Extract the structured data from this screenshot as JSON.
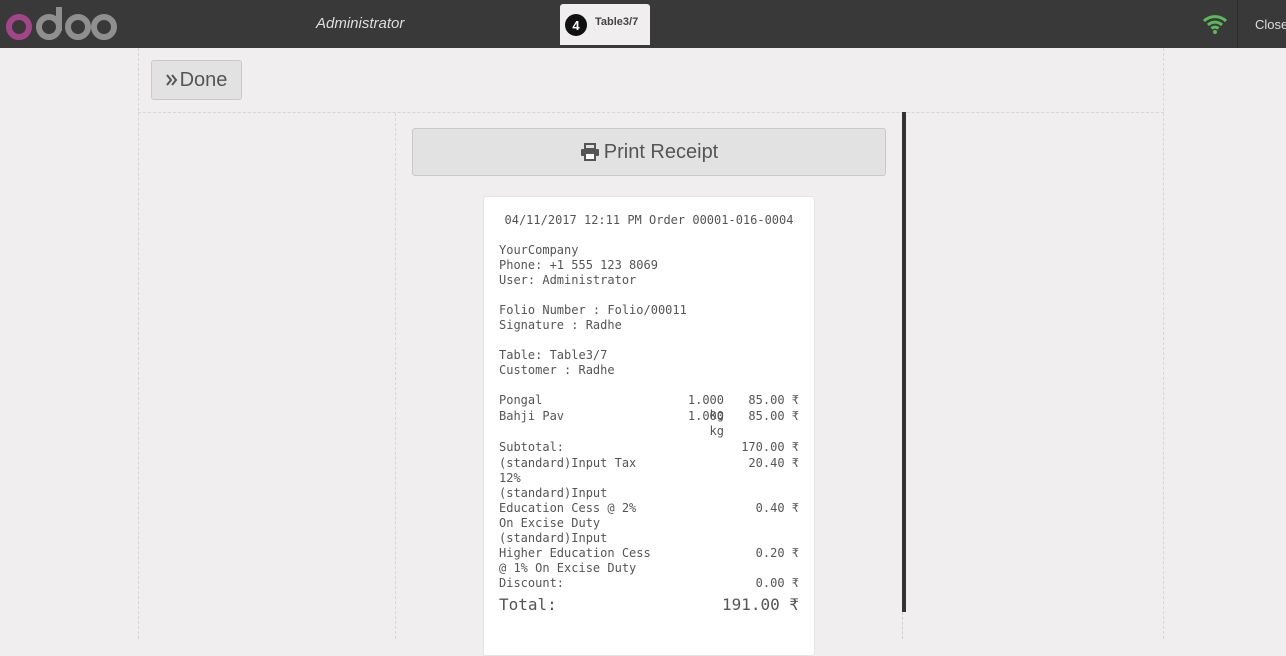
{
  "header": {
    "logo_text": "odoo",
    "user": "Administrator",
    "order_tab": {
      "badge": "4",
      "name": "Table3/7"
    },
    "close_label": "Close"
  },
  "actions": {
    "done_label": "Done",
    "print_label": "Print Receipt"
  },
  "receipt": {
    "header_line": "04/11/2017 12:11 PM Order 00001-016-0004",
    "company": "YourCompany",
    "phone": "Phone: +1 555 123 8069",
    "user": "User: Administrator",
    "folio": "Folio Number : Folio/00011",
    "signature": "Signature : Radhe",
    "table": "Table: Table3/7",
    "customer": "Customer : Radhe",
    "lines": [
      {
        "name": "Pongal",
        "qty": "1.000 kg",
        "price": "85.00 ₹"
      },
      {
        "name": "Bahji Pav",
        "qty": "1.000 kg",
        "price": "85.00 ₹"
      }
    ],
    "subtotal": {
      "label": "Subtotal:",
      "value": "170.00 ₹"
    },
    "taxes": [
      {
        "label_lines": [
          "(standard)Input Tax",
          "12%"
        ],
        "value": "20.40 ₹"
      },
      {
        "label_lines": [
          "(standard)Input",
          "Education Cess @ 2%",
          "On Excise Duty"
        ],
        "value": "0.40 ₹"
      },
      {
        "label_lines": [
          "(standard)Input",
          "Higher Education Cess",
          "@ 1% On Excise Duty"
        ],
        "value": "0.20 ₹"
      }
    ],
    "discount": {
      "label": "Discount:",
      "value": "0.00 ₹"
    },
    "total": {
      "label": "Total:",
      "value": "191.00 ₹"
    }
  },
  "colors": {
    "topbar": "#393939",
    "logo_o": "#a24689",
    "logo_rest": "#8f8f8f",
    "wifi": "#5cb85c"
  }
}
